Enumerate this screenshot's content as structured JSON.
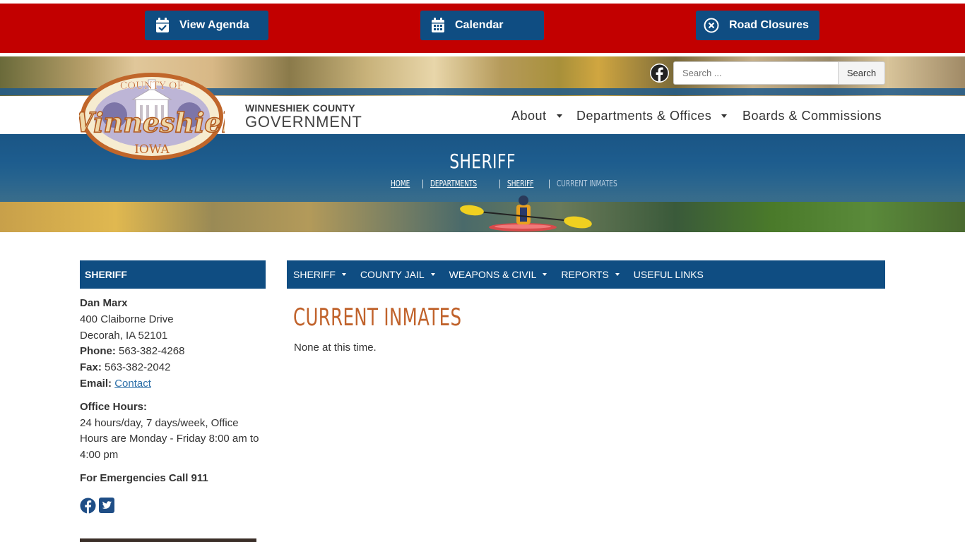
{
  "quick_links": {
    "agenda_label": "View Agenda",
    "calendar_label": "Calendar",
    "road_closures_label": "Road Closures"
  },
  "brand": {
    "line1": "WINNESHIEK COUNTY",
    "line2": "GOVERNMENT",
    "logo_top": "COUNTY OF",
    "logo_main": "Winneshiek",
    "logo_bottom": "IOWA"
  },
  "search": {
    "placeholder": "Search ...",
    "button_label": "Search"
  },
  "main_nav": {
    "about": "About",
    "departments": "Departments & Offices",
    "boards": "Boards & Commissions"
  },
  "hero": {
    "title": "SHERIFF",
    "breadcrumb": {
      "home": "HOME",
      "departments": "DEPARTMENTS",
      "sheriff": "SHERIFF",
      "current": "CURRENT INMATES",
      "separator": "|"
    }
  },
  "sidebar": {
    "heading": "SHERIFF",
    "name": "Dan Marx",
    "address1": "400 Claiborne Drive",
    "address2": "Decorah, IA 52101",
    "phone_label": "Phone:",
    "phone": "563-382-4268",
    "fax_label": "Fax:",
    "fax": "563-382-2042",
    "email_label": "Email:",
    "email_link": "Contact",
    "hours_label": "Office Hours:",
    "hours_text": "24 hours/day, 7 days/week, Office Hours are Monday - Friday 8:00 am to 4:00 pm",
    "emergency": "For Emergencies Call 911"
  },
  "sub_nav": {
    "sheriff": "SHERIFF",
    "county_jail": "COUNTY JAIL",
    "weapons_civil": "WEAPONS & CIVIL",
    "reports": "REPORTS",
    "useful_links": "USEFUL LINKS"
  },
  "content": {
    "title": "CURRENT INMATES",
    "body": "None at this time."
  },
  "colors": {
    "top_red": "#c20000",
    "brand_blue": "#0f4d82",
    "title_orange": "#c0622b",
    "link_blue": "#2c6fa8"
  },
  "icons": {
    "agenda": "calendar-check-icon",
    "calendar": "calendar-grid-icon",
    "road_closures": "circle-x-icon",
    "facebook": "facebook-icon",
    "twitter": "twitter-icon"
  }
}
